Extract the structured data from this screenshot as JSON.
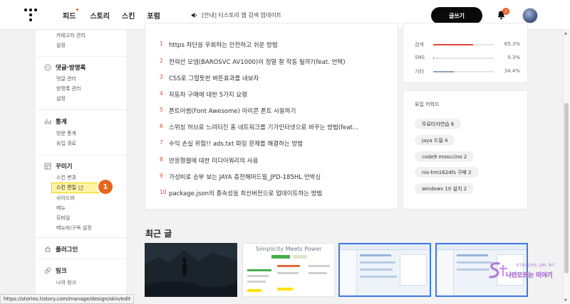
{
  "header": {
    "nav": [
      "피드",
      "스토리",
      "스킨",
      "포럼"
    ],
    "notice": "[안내] 티스토리 앱 검색 업데이트",
    "write_button": "글쓰기",
    "notification_count": "2"
  },
  "sidebar": {
    "top_items": [
      "카테고리 관리",
      "설정"
    ],
    "sections": [
      {
        "title": "댓글·방명록",
        "items": [
          "댓글 관리",
          "방명록 관리",
          "설정"
        ]
      },
      {
        "title": "통계",
        "items": [
          "방문 통계",
          "유입 경로"
        ]
      },
      {
        "title": "꾸미기",
        "items": [
          "스킨 변경",
          "스킨 편집",
          "사이드바",
          "메뉴",
          "모바일",
          "메뉴바/구독 설정"
        ]
      },
      {
        "title": "플러그인",
        "items": []
      },
      {
        "title": "링크",
        "items": [
          "나의 링크"
        ]
      }
    ],
    "callout_number": "1"
  },
  "popular_posts": [
    {
      "rank": "1",
      "title": "https 차단을 우회하는 안전하고 쉬운 방법"
    },
    {
      "rank": "2",
      "title": "전력선 모뎀(BAROSVC AV1000)이 정말 잘 작동 될까?(feat. 언택)"
    },
    {
      "rank": "3",
      "title": "CSS로 그럴듯한 버튼효과를 내보자"
    },
    {
      "rank": "4",
      "title": "자동차 구매에 대한 5가지 요령"
    },
    {
      "rank": "5",
      "title": "폰트어썸(Font Awesome) 아이콘 폰트 사용하기"
    },
    {
      "rank": "6",
      "title": "스위칭 허브로 느려터진 홈 네트워크를 기가인터넷으로 바꾸는 방법(feat…"
    },
    {
      "rank": "7",
      "title": "수익 손실 위험!! ads.txt 파일 문제를 해결하는 방법"
    },
    {
      "rank": "8",
      "title": "반응형웹에 대한 미디어쿼리의 사용"
    },
    {
      "rank": "9",
      "title": "가성비로 승부 보는 JAYA 충전해머드릴_JPD-185HL 언박싱"
    },
    {
      "rank": "10",
      "title": "package.json의 종속성을 최신버전으로 업데이트하는 방법"
    }
  ],
  "traffic_sources": [
    {
      "label": "검색",
      "percent": "65.3%",
      "value": 65.3,
      "color": "#e2483b"
    },
    {
      "label": "SNS",
      "percent": "0.3%",
      "value": 0.3,
      "color": "#e2483b"
    },
    {
      "label": "기타",
      "percent": "34.4%",
      "value": 34.4,
      "color": "#8da2c0"
    }
  ],
  "keywords": {
    "title": "유입 키워드",
    "items": [
      "무료타자연습 6",
      "jaya 드릴 4",
      "code9 mosccino 2",
      "nis-hm1624fs 구매 2",
      "windows 10 설치 2"
    ]
  },
  "recent": {
    "title": "최근 글",
    "thumb2_text": "Simplicity Meets Power"
  },
  "watermark": {
    "site": "stories.pe.kr",
    "tagline": "나만모르는 이야기"
  },
  "status_url": "https://stories.tistory.com/manage/design/skin/edit"
}
